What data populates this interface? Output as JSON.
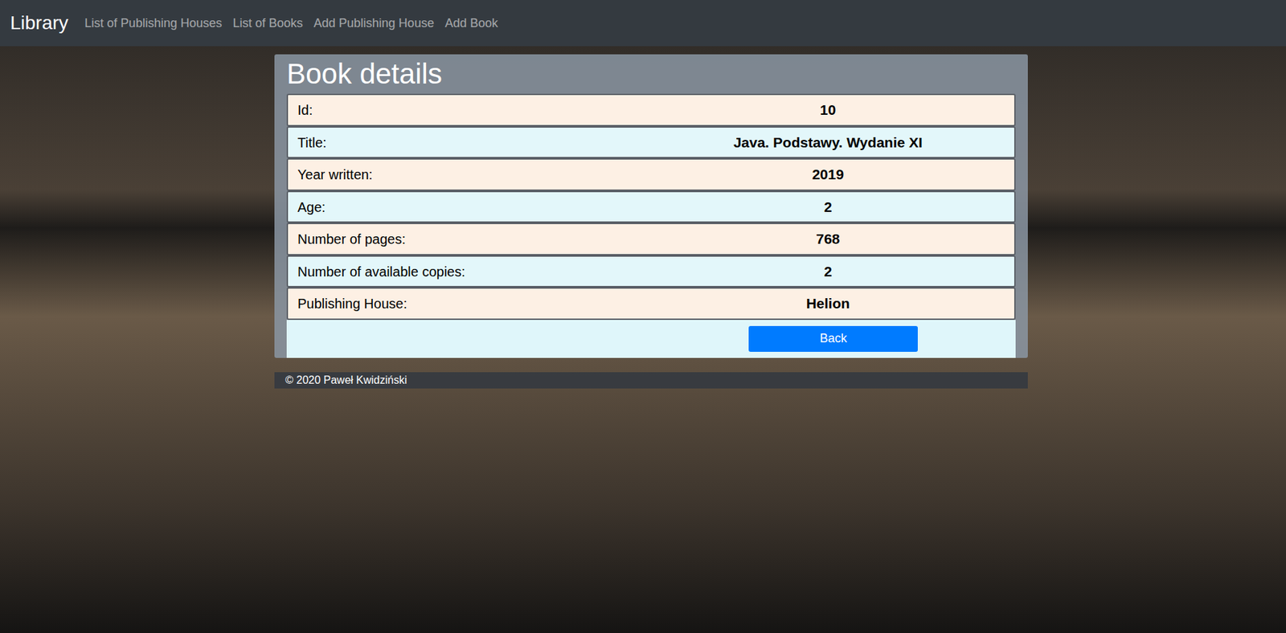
{
  "navbar": {
    "brand": "Library",
    "links": [
      "List of Publishing Houses",
      "List of Books",
      "Add Publishing House",
      "Add Book"
    ]
  },
  "card": {
    "title": "Book details",
    "rows": [
      {
        "label": "Id:",
        "value": "10"
      },
      {
        "label": "Title:",
        "value": "Java. Podstawy. Wydanie XI"
      },
      {
        "label": "Year written:",
        "value": "2019"
      },
      {
        "label": "Age:",
        "value": "2"
      },
      {
        "label": "Number of pages:",
        "value": "768"
      },
      {
        "label": "Number of available copies:",
        "value": "2"
      },
      {
        "label": "Publishing House:",
        "value": "Helion"
      }
    ],
    "button": "Back"
  },
  "footer": "© 2020 Paweł Kwidziński"
}
